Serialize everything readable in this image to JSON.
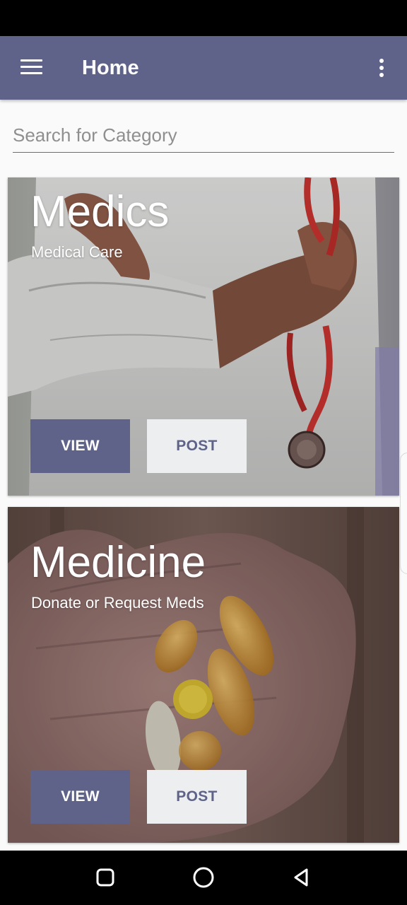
{
  "app_bar": {
    "title": "Home",
    "menu_icon": "hamburger-menu-icon",
    "overflow_icon": "more-vertical-icon",
    "color": "#5f6389"
  },
  "search": {
    "placeholder": "Search for Category",
    "value": ""
  },
  "cards": [
    {
      "title": "Medics",
      "subtitle": "Medical Care",
      "image": "doctor-with-stethoscope",
      "view_label": "VIEW",
      "post_label": "POST"
    },
    {
      "title": "Medicine",
      "subtitle": "Donate or Request Meds",
      "image": "pills-in-hand",
      "view_label": "VIEW",
      "post_label": "POST"
    }
  ],
  "nav_bar": {
    "recents_icon": "square-recents-icon",
    "home_icon": "circle-home-icon",
    "back_icon": "triangle-back-icon"
  }
}
